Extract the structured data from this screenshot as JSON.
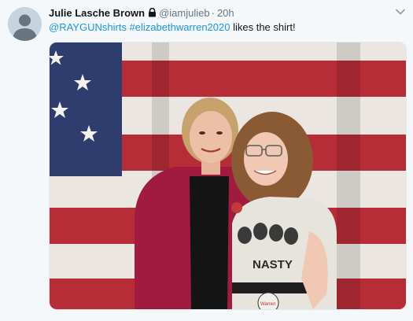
{
  "tweet": {
    "author_name": "Julie Lasche Brown",
    "author_handle": "@iamjulieb",
    "separator": "·",
    "timestamp": "20h",
    "mention": "@RAYGUNshirts",
    "hashtag": "#elizabethwarren2020",
    "body_text": " likes the shirt!",
    "shirt_text": "NASTY",
    "button_text": "Warren",
    "icons": {
      "avatar": "default-profile-icon",
      "protected": "lock-icon",
      "menu": "chevron-down-icon"
    }
  },
  "colors": {
    "link": "#1b95e0",
    "name": "#14171a",
    "meta": "#657786",
    "background": "#f5f8fa"
  }
}
